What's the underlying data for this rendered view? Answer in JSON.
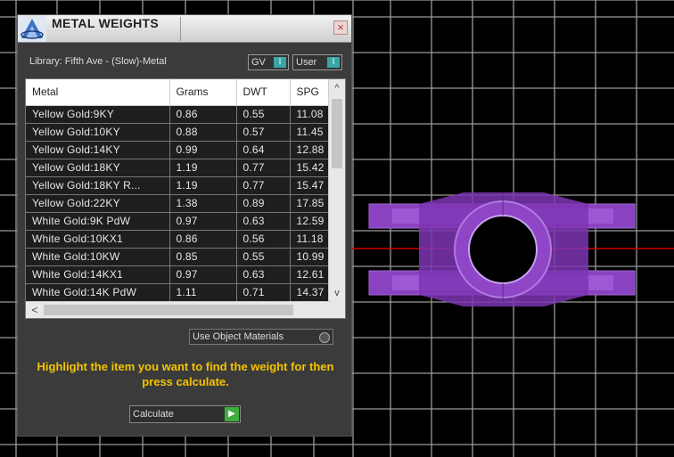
{
  "panel": {
    "title": "METAL WEIGHTS",
    "close_glyph": "×",
    "library": "Library: Fifth Ave - (Slow)-Metal",
    "toggles": [
      {
        "label": "GV",
        "knob": "I"
      },
      {
        "label": "User",
        "knob": "I"
      }
    ]
  },
  "table": {
    "columns": [
      "Metal",
      "Grams",
      "DWT",
      "SPG"
    ],
    "rows": [
      [
        "Yellow Gold:9KY",
        "0.86",
        "0.55",
        "11.08"
      ],
      [
        "Yellow Gold:10KY",
        "0.88",
        "0.57",
        "11.45"
      ],
      [
        "Yellow Gold:14KY",
        "0.99",
        "0.64",
        "12.88"
      ],
      [
        "Yellow Gold:18KY",
        "1.19",
        "0.77",
        "15.42"
      ],
      [
        "Yellow Gold:18KY R...",
        "1.19",
        "0.77",
        "15.47"
      ],
      [
        "Yellow Gold:22KY",
        "1.38",
        "0.89",
        "17.85"
      ],
      [
        "White Gold:9K PdW",
        "0.97",
        "0.63",
        "12.59"
      ],
      [
        "White Gold:10KX1",
        "0.86",
        "0.56",
        "11.18"
      ],
      [
        "White Gold:10KW",
        "0.85",
        "0.55",
        "10.99"
      ],
      [
        "White Gold:14KX1",
        "0.97",
        "0.63",
        "12.61"
      ],
      [
        "White Gold:14K PdW",
        "1.11",
        "0.71",
        "14.37"
      ]
    ],
    "scroll": {
      "up": "^",
      "down": "v",
      "left": "<",
      "right": ">"
    }
  },
  "use_object_materials": "Use Object Materials",
  "hint": "Highlight the item you want to find the weight for then press calculate.",
  "calculate_label": "Calculate",
  "colors": {
    "viewport_bg": "#000000",
    "grid_line": "#b0b0b0",
    "axis_line": "#c00000",
    "object_fill": "#9b4fcf",
    "hint_text": "#f5c400"
  }
}
